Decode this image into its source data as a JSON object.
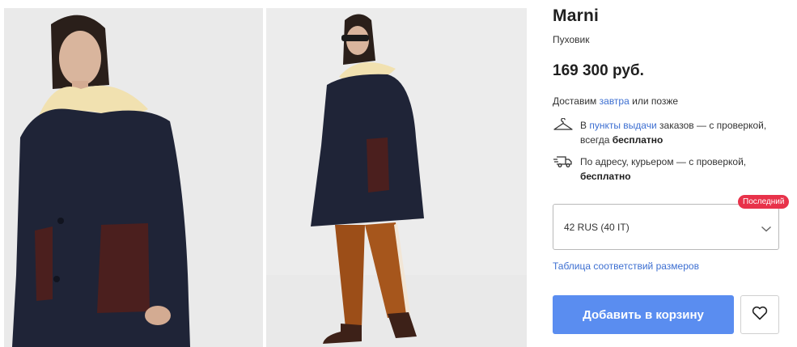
{
  "gallery": {
    "images": [
      {
        "alt": "photo-front"
      },
      {
        "alt": "photo-full"
      }
    ]
  },
  "product": {
    "brand": "Marni",
    "category": "Пуховик",
    "price": "169 300 руб."
  },
  "delivery": {
    "prefix": "Доставим ",
    "day_link": "завтра",
    "suffix": " или позже",
    "options": [
      {
        "icon": "hanger-icon",
        "text_prefix": "В ",
        "link": "пункты выдачи",
        "text_middle": " заказов — с проверкой, всегда ",
        "bold": "бесплатно"
      },
      {
        "icon": "courier-truck-icon",
        "text_prefix": "По адресу, курьером — с проверкой, ",
        "bold": "бесплатно"
      }
    ]
  },
  "size": {
    "selected": "42 RUS (40 IT)",
    "badge": "Последний",
    "table_link": "Таблица соответствий размеров"
  },
  "actions": {
    "add_to_cart": "Добавить в корзину",
    "favorite_icon": "heart-icon"
  },
  "colors": {
    "accent_button": "#5a8df0",
    "link": "#3d6fd1",
    "badge": "#e8324a"
  }
}
